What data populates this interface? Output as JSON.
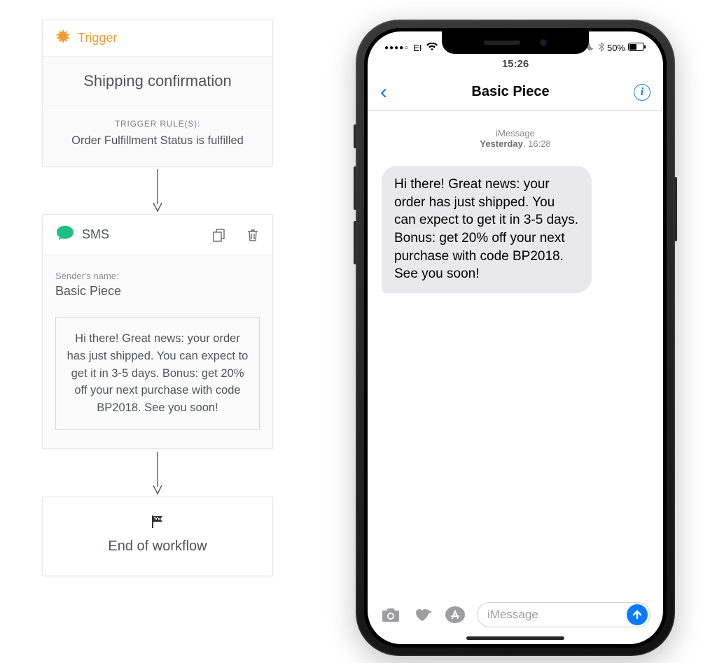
{
  "workflow": {
    "trigger": {
      "head_label": "Trigger",
      "title": "Shipping confirmation",
      "rules_label": "TRIGGER RULE(S):",
      "rules_text": "Order Fulfillment Status is fulfilled"
    },
    "sms": {
      "head_label": "SMS",
      "sender_label": "Sender's name:",
      "sender_value": "Basic Piece",
      "message": "Hi there! Great news: your order has just shipped. You can expect to get it in 3-5 days. Bonus: get 20% off your next purchase with code BP2018. See you soon!"
    },
    "end": {
      "label": "End of workflow"
    }
  },
  "phone": {
    "status": {
      "signal_dots": "●●●●○",
      "carrier": "EI",
      "time": "15:26",
      "battery_pct": "50%"
    },
    "nav": {
      "title": "Basic Piece"
    },
    "thread": {
      "channel": "iMessage",
      "day": "Yesterday",
      "time": "16:28",
      "bubble": "Hi there! Great news: your order has just shipped. You can expect to get it in 3-5 days. Bonus: get 20% off your next purchase with code BP2018. See you soon!"
    },
    "input": {
      "placeholder": "iMessage"
    }
  }
}
